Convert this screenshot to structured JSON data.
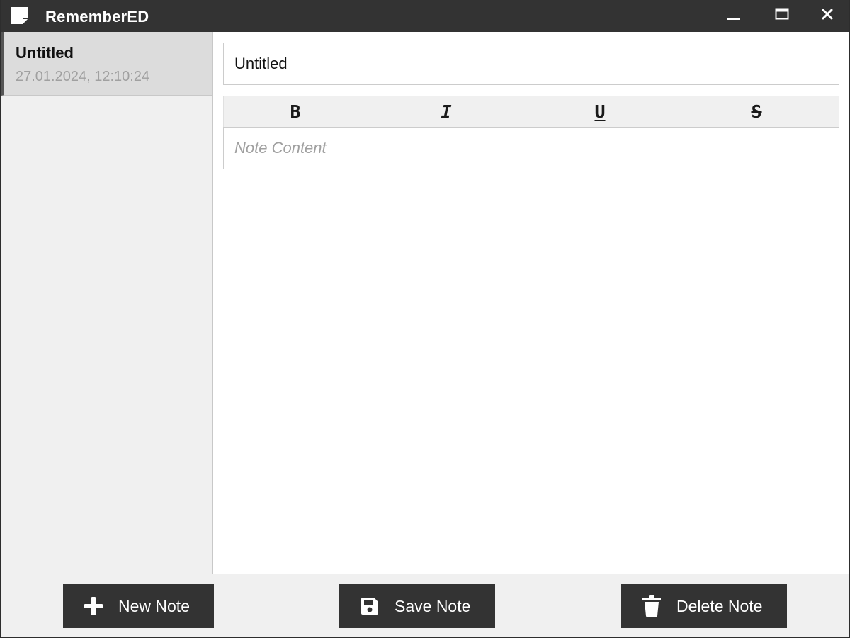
{
  "window": {
    "title": "RememberED",
    "icon": "sticky-note-icon"
  },
  "titlebar_controls": {
    "minimize_icon": "minimize-icon",
    "maximize_icon": "maximize-icon",
    "close_icon": "close-icon"
  },
  "sidebar": {
    "notes": [
      {
        "title": "Untitled",
        "date": "27.01.2024, 12:10:24",
        "selected": true
      }
    ]
  },
  "editor": {
    "title_value": "Untitled",
    "title_placeholder": "",
    "content_value": "",
    "content_placeholder": "Note Content",
    "format_buttons": [
      {
        "label": "B",
        "name": "bold"
      },
      {
        "label": "I",
        "name": "italic"
      },
      {
        "label": "U",
        "name": "underline"
      },
      {
        "label": "S",
        "name": "strikethrough"
      }
    ]
  },
  "actions": {
    "new_label": "New Note",
    "new_icon": "plus-icon",
    "save_label": "Save Note",
    "save_icon": "floppy-disk-icon",
    "delete_label": "Delete Note",
    "delete_icon": "trash-icon"
  },
  "colors": {
    "titlebar_bg": "#333333",
    "button_bg": "#333333",
    "sidebar_bg": "#f0f0f0",
    "selected_item_bg": "#dcdcdc",
    "date_text": "#a0a0a0"
  }
}
